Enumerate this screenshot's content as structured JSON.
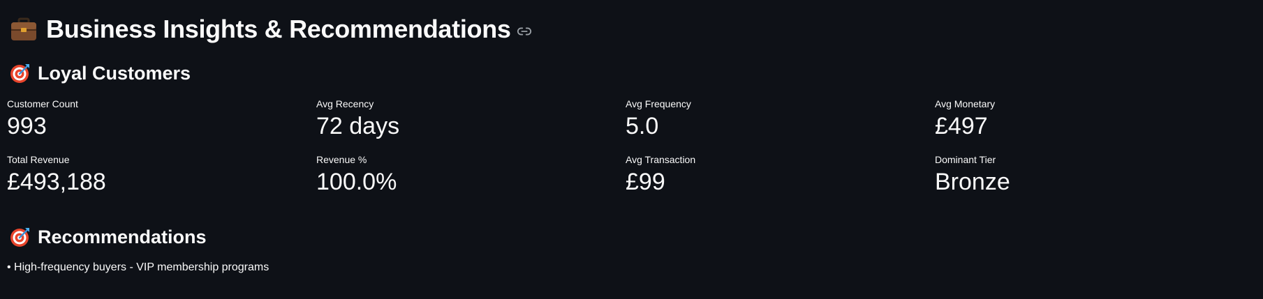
{
  "header": {
    "title": "Business Insights & Recommendations",
    "icon": "briefcase-icon",
    "link_icon": "link-icon"
  },
  "segment": {
    "title": "Loyal Customers",
    "icon": "target-icon"
  },
  "metrics": [
    {
      "label": "Customer Count",
      "value": "993"
    },
    {
      "label": "Avg Recency",
      "value": "72 days"
    },
    {
      "label": "Avg Frequency",
      "value": "5.0"
    },
    {
      "label": "Avg Monetary",
      "value": "£497"
    },
    {
      "label": "Total Revenue",
      "value": "£493,188"
    },
    {
      "label": "Revenue %",
      "value": "100.0%"
    },
    {
      "label": "Avg Transaction",
      "value": "£99"
    },
    {
      "label": "Dominant Tier",
      "value": "Bronze"
    }
  ],
  "recommendations": {
    "title": "Recommendations",
    "icon": "target-icon",
    "items": [
      "• High-frequency buyers - VIP membership programs"
    ]
  },
  "colors": {
    "background": "#0e1117",
    "text": "#fafafa"
  }
}
